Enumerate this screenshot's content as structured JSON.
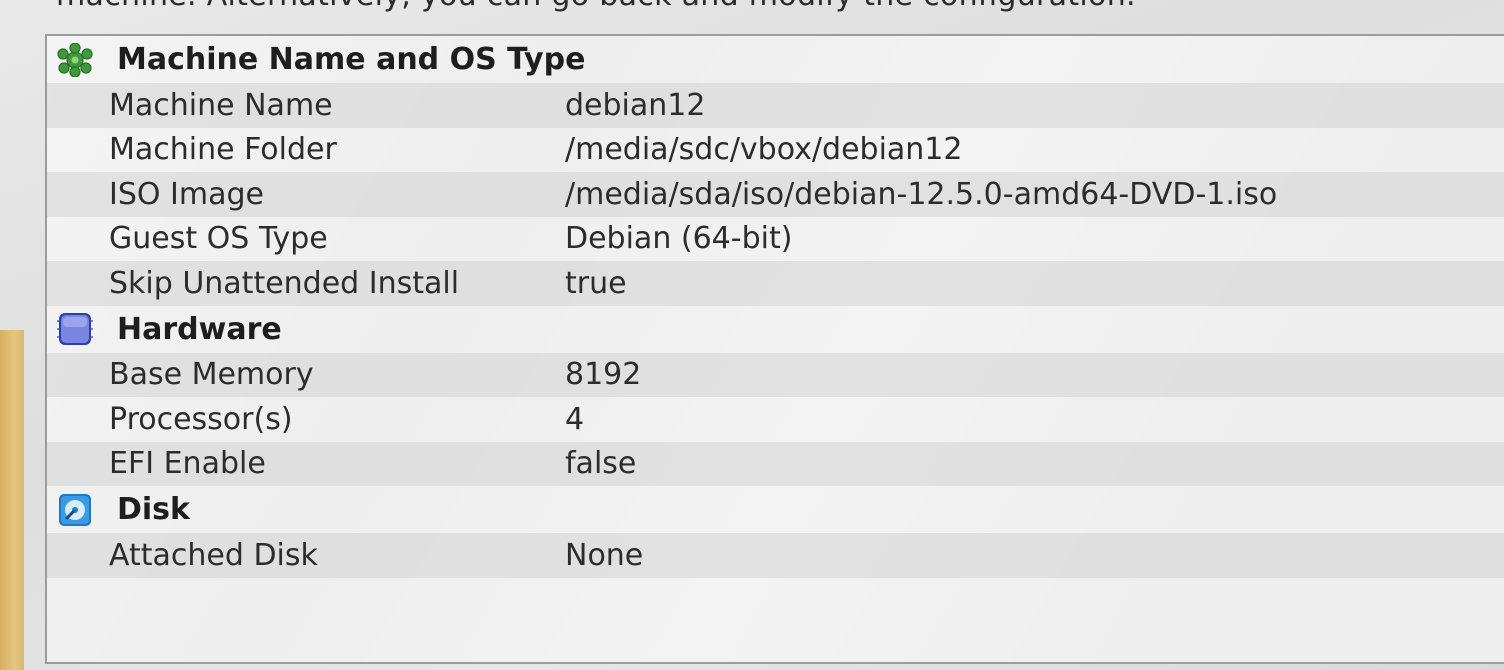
{
  "header_cutoff_text": "machine. Alternatively, you can go back and modify the configuration.",
  "sections": [
    {
      "title": "Machine Name and OS Type",
      "icon": "gear-puzzle-icon",
      "rows": [
        {
          "key": "Machine Name",
          "value": "debian12"
        },
        {
          "key": "Machine Folder",
          "value": "/media/sdc/vbox/debian12"
        },
        {
          "key": "ISO Image",
          "value": "/media/sda/iso/debian-12.5.0-amd64-DVD-1.iso"
        },
        {
          "key": "Guest OS Type",
          "value": "Debian (64-bit)"
        },
        {
          "key": "Skip Unattended Install",
          "value": "true"
        }
      ]
    },
    {
      "title": "Hardware",
      "icon": "chip-icon",
      "rows": [
        {
          "key": "Base Memory",
          "value": "8192"
        },
        {
          "key": "Processor(s)",
          "value": "4"
        },
        {
          "key": "EFI Enable",
          "value": "false"
        }
      ]
    },
    {
      "title": "Disk",
      "icon": "disk-icon",
      "rows": [
        {
          "key": "Attached Disk",
          "value": "None"
        }
      ]
    }
  ]
}
